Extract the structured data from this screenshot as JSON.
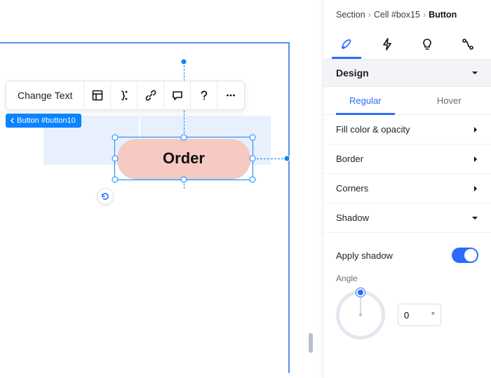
{
  "canvas": {
    "element_tag": "Button #button10",
    "button_label": "Order"
  },
  "toolbar": {
    "change_text": "Change Text"
  },
  "breadcrumb": {
    "items": [
      "Section",
      "Cell #box15",
      "Button"
    ]
  },
  "panel": {
    "section_head": "Design",
    "subtabs": {
      "regular": "Regular",
      "hover": "Hover"
    },
    "rows": {
      "fill": "Fill color & opacity",
      "border": "Border",
      "corners": "Corners",
      "shadow": "Shadow",
      "apply_shadow": "Apply shadow"
    },
    "angle": {
      "label": "Angle",
      "value": "0",
      "unit": "°"
    },
    "apply_shadow_on": true
  },
  "colors": {
    "accent": "#2b6cff",
    "button_fill": "#f6c9c2"
  }
}
